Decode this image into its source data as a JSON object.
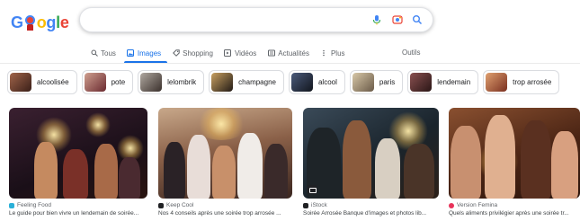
{
  "logo": {
    "g1": "G",
    "rest": "ogle",
    "letters": [
      "o",
      "g",
      "l",
      "e"
    ]
  },
  "search": {
    "value": "",
    "icons": [
      "microphone-icon",
      "camera-lens-icon",
      "search-icon"
    ]
  },
  "tabs": [
    {
      "label": "Tous",
      "icon": "search-icon"
    },
    {
      "label": "Images",
      "icon": "image-icon",
      "active": true
    },
    {
      "label": "Shopping",
      "icon": "tag-icon"
    },
    {
      "label": "Vidéos",
      "icon": "play-icon"
    },
    {
      "label": "Actualités",
      "icon": "newspaper-icon"
    },
    {
      "label": "Plus",
      "icon": "more-vert-icon"
    }
  ],
  "tools_label": "Outils",
  "chips": [
    {
      "label": "alcoolisée",
      "color": "#6b3a2a"
    },
    {
      "label": "pote",
      "color": "#8d3b3f"
    },
    {
      "label": "lelombrik",
      "color": "#5a4a45"
    },
    {
      "label": "champagne",
      "color": "#3b2f2a"
    },
    {
      "label": "alcool",
      "color": "#2a2f3f"
    },
    {
      "label": "paris",
      "color": "#7a6a55"
    },
    {
      "label": "lendemain",
      "color": "#4a3030"
    },
    {
      "label": "trop arrosée",
      "color": "#9a4a3a"
    }
  ],
  "results": [
    {
      "source": "Feeling Food",
      "title": "Le guide pour bien vivre un lendemain de soirée...",
      "fav_color": "#2ab0d8",
      "bg": "#2a1a2a"
    },
    {
      "source": "Keep Cool",
      "title": "Nos 4 conseils après une soirée trop arrosée ...",
      "fav_color": "#202124",
      "bg": "#6a4a3a"
    },
    {
      "source": "iStock",
      "title": "Soirée Arrosée Banque d'images et photos lib...",
      "fav_color": "#202124",
      "bg": "#1e2a32"
    },
    {
      "source": "Version Femina",
      "title": "Quels aliments privilégier après une soirée tr...",
      "fav_color": "#e8335a",
      "bg": "#5a3020"
    }
  ]
}
